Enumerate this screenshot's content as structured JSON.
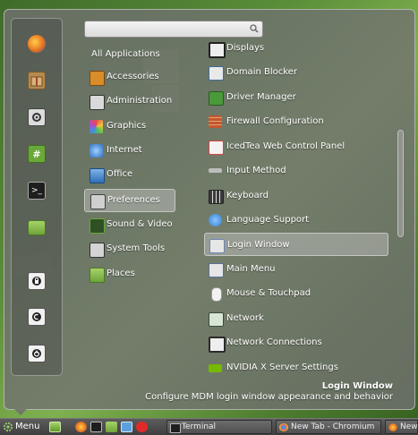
{
  "search": {
    "value": "",
    "placeholder": ""
  },
  "categories": [
    {
      "label": "All Applications",
      "icon": "all-apps"
    },
    {
      "label": "Accessories",
      "icon": "accessories-icon",
      "color": "#d98c2a"
    },
    {
      "label": "Administration",
      "icon": "administration-icon",
      "color": "#8e8e8e"
    },
    {
      "label": "Graphics",
      "icon": "graphics-icon",
      "color": "#d64aa8"
    },
    {
      "label": "Internet",
      "icon": "internet-icon",
      "color": "#4a8fd6"
    },
    {
      "label": "Office",
      "icon": "office-icon",
      "color": "#3f7ec0"
    },
    {
      "label": "Preferences",
      "icon": "preferences-icon",
      "color": "#9a9a9a"
    },
    {
      "label": "Sound & Video",
      "icon": "sound-video-icon",
      "color": "#4e8f2f"
    },
    {
      "label": "System Tools",
      "icon": "system-tools-icon",
      "color": "#7a7a7a"
    },
    {
      "label": "Places",
      "icon": "places-icon",
      "color": "#8cc04a"
    }
  ],
  "apps": [
    {
      "label": "Displays",
      "icon": "displays-icon",
      "color": "#2b2b2b"
    },
    {
      "label": "Domain Blocker",
      "icon": "domain-blocker-icon",
      "color": "#3d6f9e"
    },
    {
      "label": "Driver Manager",
      "icon": "driver-manager-icon",
      "color": "#4a9a3a"
    },
    {
      "label": "Firewall Configuration",
      "icon": "firewall-icon",
      "color": "#c4572c"
    },
    {
      "label": "IcedTea Web Control Panel",
      "icon": "icedtea-icon",
      "color": "#d94141"
    },
    {
      "label": "Input Method",
      "icon": "input-method-icon",
      "color": "#bdbdbd"
    },
    {
      "label": "Keyboard",
      "icon": "keyboard-icon",
      "color": "#3a3a3a"
    },
    {
      "label": "Language Support",
      "icon": "language-support-icon",
      "color": "#2f7ed0"
    },
    {
      "label": "Login Window",
      "icon": "login-window-icon",
      "color": "#6d86b6"
    },
    {
      "label": "Main Menu",
      "icon": "main-menu-icon",
      "color": "#5c6e9e"
    },
    {
      "label": "Mouse & Touchpad",
      "icon": "mouse-icon",
      "color": "#eeeeee"
    },
    {
      "label": "Network",
      "icon": "network-icon",
      "color": "#3b4a3b"
    },
    {
      "label": "Network Connections",
      "icon": "network-connections-icon",
      "color": "#2b2b2b"
    },
    {
      "label": "NVIDIA X Server Settings",
      "icon": "nvidia-icon",
      "color": "#76b900"
    }
  ],
  "selected": {
    "title": "Login Window",
    "description": "Configure MDM login window appearance and behavior"
  },
  "favorites": [
    {
      "name": "firefox-icon",
      "color": "#e8731f"
    },
    {
      "name": "package-icon",
      "color": "#b58a50"
    },
    {
      "name": "settings-icon",
      "color": "#555555"
    },
    {
      "name": "hashtag-icon",
      "color": "#6aa83a"
    },
    {
      "name": "terminal-icon",
      "color": "#1e1e1e"
    },
    {
      "name": "folder-icon",
      "color": "#8cc04a"
    },
    {
      "name": "lock-icon",
      "color": "#2b2b2b"
    },
    {
      "name": "logout-icon",
      "color": "#2b2b2b"
    },
    {
      "name": "power-icon",
      "color": "#2b2b2b"
    }
  ],
  "taskbar": {
    "menu_label": "Menu",
    "launchers": [
      "show-desktop-icon",
      "firefox-icon",
      "terminal-icon",
      "files-icon",
      "screenshot-icon",
      "opera-icon"
    ],
    "tasks": [
      {
        "label": "Terminal",
        "icon": "terminal-icon"
      },
      {
        "label": "New Tab - Chromium",
        "icon": "chromium-icon"
      },
      {
        "label": "New",
        "icon": "firefox-icon"
      }
    ]
  }
}
